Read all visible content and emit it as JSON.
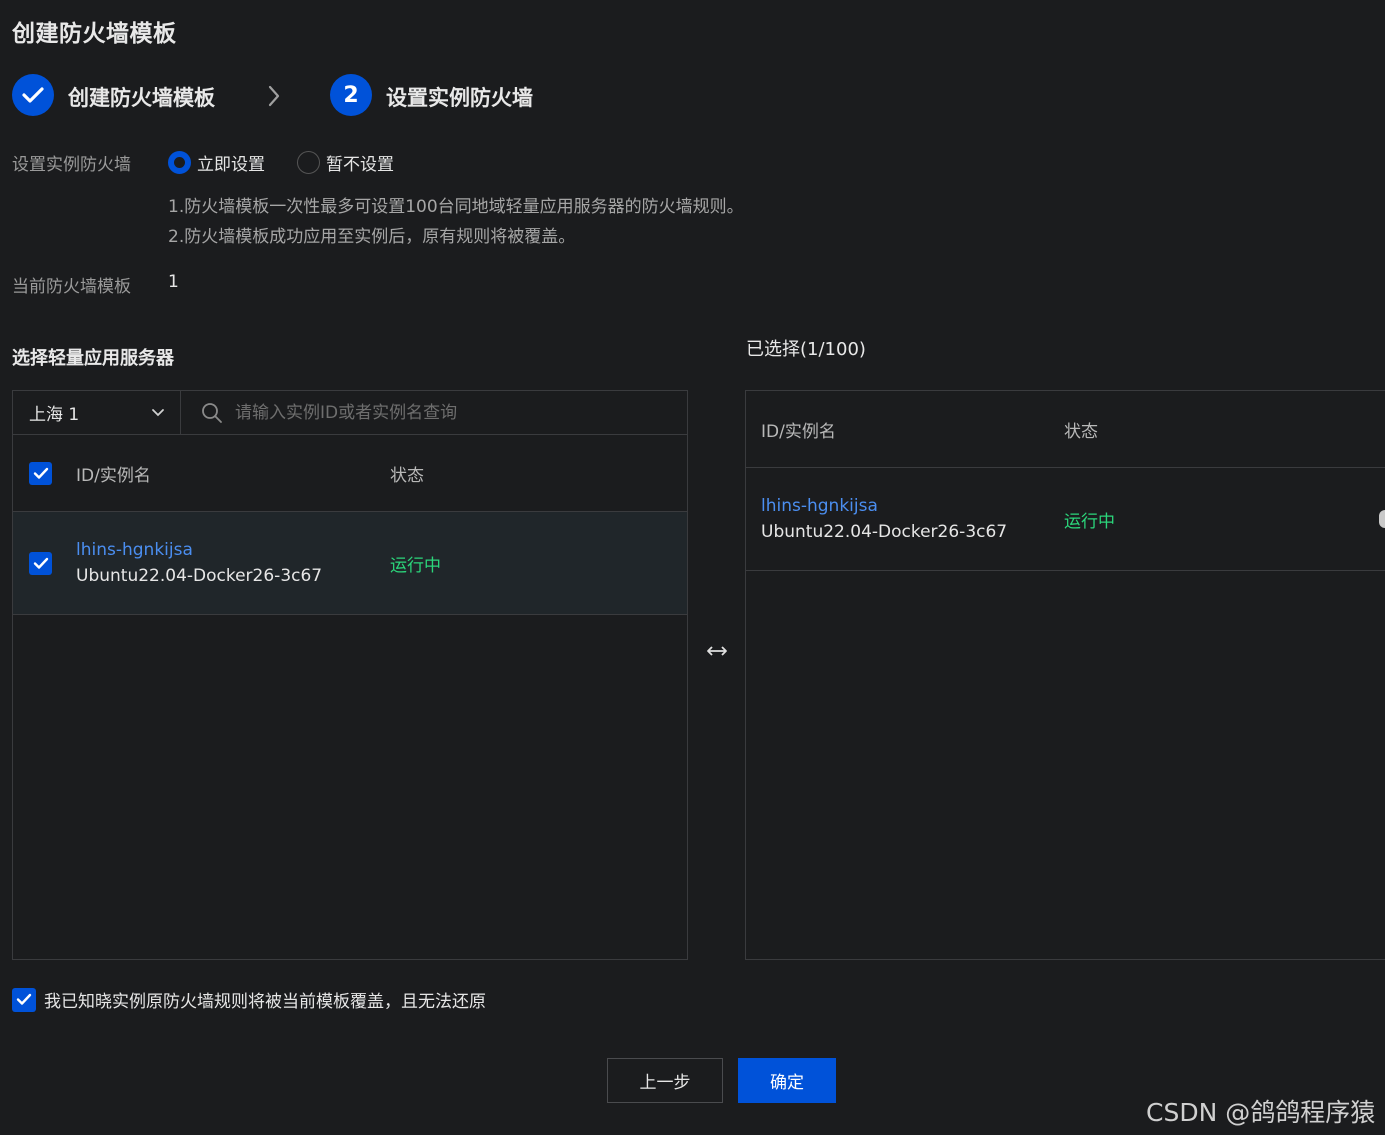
{
  "page": {
    "title": "创建防火墙模板"
  },
  "steps": [
    {
      "label": "创建防火墙模板",
      "state": "done"
    },
    {
      "number": "2",
      "label": "设置实例防火墙",
      "state": "active"
    }
  ],
  "form": {
    "setting_label": "设置实例防火墙",
    "radio_now": "立即设置",
    "radio_later": "暂不设置",
    "hints": [
      "1.防火墙模板一次性最多可设置100台同地域轻量应用服务器的防火墙规则。",
      "2.防火墙模板成功应用至实例后，原有规则将被覆盖。"
    ],
    "template_label": "当前防火墙模板",
    "template_value": "1"
  },
  "left_panel": {
    "title": "选择轻量应用服务器",
    "region": "上海 1",
    "search_placeholder": "请输入实例ID或者实例名查询",
    "columns": [
      "ID/实例名",
      "状态"
    ],
    "rows": [
      {
        "id": "lhins-hgnkijsa",
        "name": "Ubuntu22.04-Docker26-3c67",
        "status": "运行中",
        "checked": true
      }
    ]
  },
  "right_panel": {
    "title": "已选择(1/100)",
    "columns": [
      "ID/实例名",
      "状态"
    ],
    "rows": [
      {
        "id": "lhins-hgnkijsa",
        "name": "Ubuntu22.04-Docker26-3c67",
        "status": "运行中"
      }
    ]
  },
  "agreement": {
    "text": "我已知晓实例原防火墙规则将被当前模板覆盖，且无法还原",
    "checked": true
  },
  "buttons": {
    "prev": "上一步",
    "ok": "确定"
  },
  "watermark": "CSDN @鸽鸽程序猿",
  "colors": {
    "accent": "#0052d9",
    "running": "#2bd67b",
    "link": "#4b8ef0",
    "background": "#1b1c1e"
  },
  "icons": [
    "check-icon",
    "chevron-right-icon",
    "chevron-down-icon",
    "search-icon",
    "swap-icon"
  ]
}
